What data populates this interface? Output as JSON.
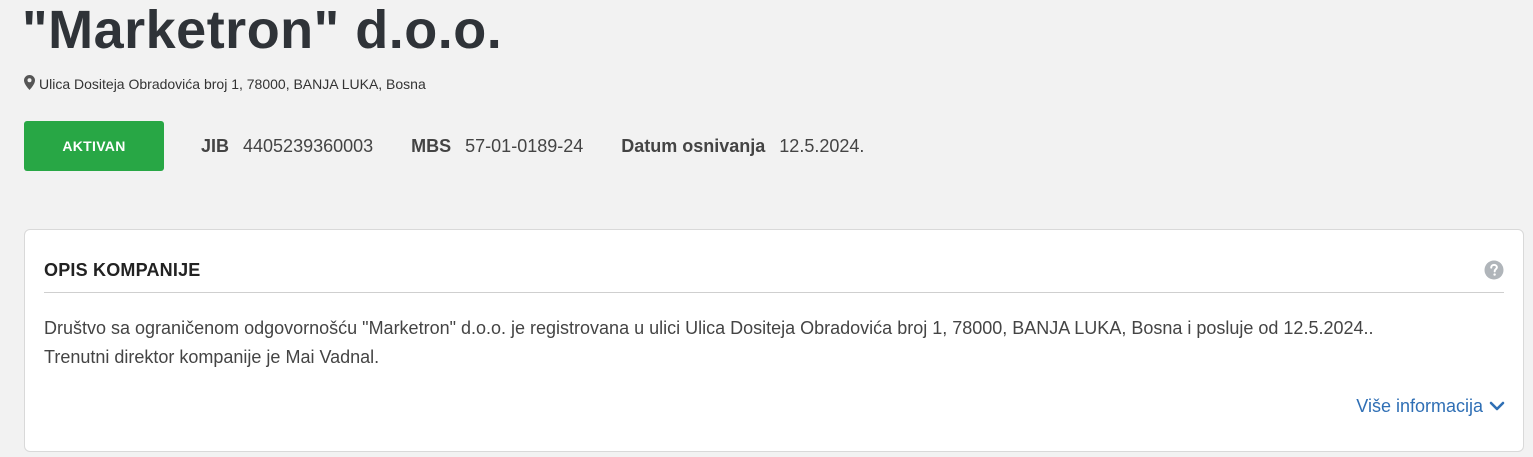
{
  "company": {
    "name": "\"Marketron\" d.o.o.",
    "address": "Ulica Dositeja Obradovića broj 1, 78000, BANJA LUKA, Bosna",
    "location_icon": "map-marker-icon"
  },
  "status": {
    "label": "AKTIVAN",
    "color": "#28a745"
  },
  "meta": {
    "jib_label": "JIB",
    "jib_value": "4405239360003",
    "mbs_label": "MBS",
    "mbs_value": "57-01-0189-24",
    "date_label": "Datum osnivanja",
    "date_value": "12.5.2024."
  },
  "description_card": {
    "title": "OPIS KOMPANIJE",
    "help_icon": "question-circle-icon",
    "line1": "Društvo sa ograničenom odgovornošću \"Marketron\" d.o.o. je registrovana u ulici Ulica Dositeja Obradovića broj 1, 78000, BANJA LUKA, Bosna i posluje od 12.5.2024..",
    "line2": "Trenutni direktor kompanije je Mai Vadnal.",
    "more_label": "Više informacija",
    "more_icon": "chevron-down-icon",
    "link_color": "#2f6fb5"
  }
}
